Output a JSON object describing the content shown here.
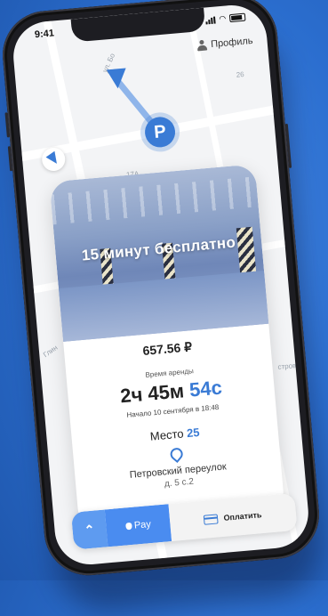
{
  "status_bar": {
    "time": "9:41"
  },
  "header": {
    "profile_label": "Профиль"
  },
  "map": {
    "street_labels": [
      "ул. Бо",
      "17А",
      "26",
      "Глин",
      "стров"
    ]
  },
  "parking_card": {
    "photo_caption": "15 минут бесплатно",
    "price": "657.56 ₽",
    "rent_time_label": "Время аренды",
    "rent_time_hm": "2ч 45м",
    "rent_time_sec": "54с",
    "started_at": "Начало 10 сентября в 18:48",
    "place_label": "Место",
    "place_number": "25",
    "address_line1": "Петровский переулок",
    "address_line2": "д. 5 с.2"
  },
  "bottom_bar": {
    "apple_pay_label": "Pay",
    "pay_label": "Оплатить"
  },
  "icons": {
    "parking_pin": "P"
  },
  "colors": {
    "accent": "#3a7bd5",
    "background": "#2b6ecf"
  }
}
